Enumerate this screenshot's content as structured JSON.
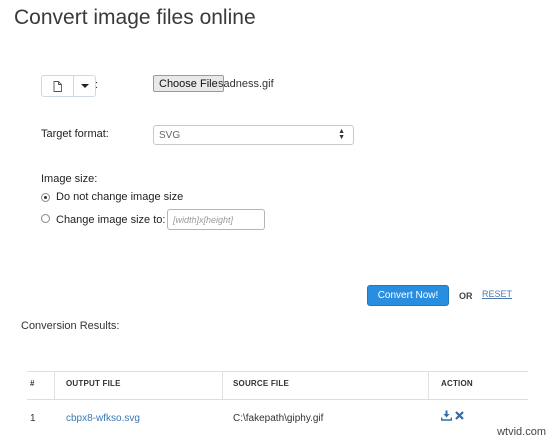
{
  "page": {
    "title": "Convert image files online"
  },
  "source": {
    "colon": ":",
    "choose_file_label": "Choose File",
    "file_name": "sadness.gif"
  },
  "target_format": {
    "label": "Target format:",
    "selected": "SVG"
  },
  "image_size": {
    "label": "Image size:",
    "options": [
      {
        "label": "Do not change image size",
        "checked": true
      },
      {
        "label": "Change image size to:",
        "checked": false
      }
    ],
    "input_placeholder": "[width]x[height]"
  },
  "actions": {
    "convert_label": "Convert Now!",
    "or_label": "OR",
    "reset_label": "RESET"
  },
  "results": {
    "heading": "Conversion Results:",
    "columns": [
      "#",
      "OUTPUT FILE",
      "SOURCE FILE",
      "ACTION"
    ],
    "rows": [
      {
        "index": "1",
        "output_file": "cbpx8-wfkso.svg",
        "source_file": "C:\\fakepath\\giphy.gif"
      }
    ]
  },
  "watermark": "wtvid.com",
  "colors": {
    "accent": "#2a8ee0",
    "link": "#3a78b5"
  },
  "icons": {
    "source": "file-icon",
    "dropdown": "caret-down-icon",
    "download": "download-icon",
    "delete": "delete-icon"
  }
}
